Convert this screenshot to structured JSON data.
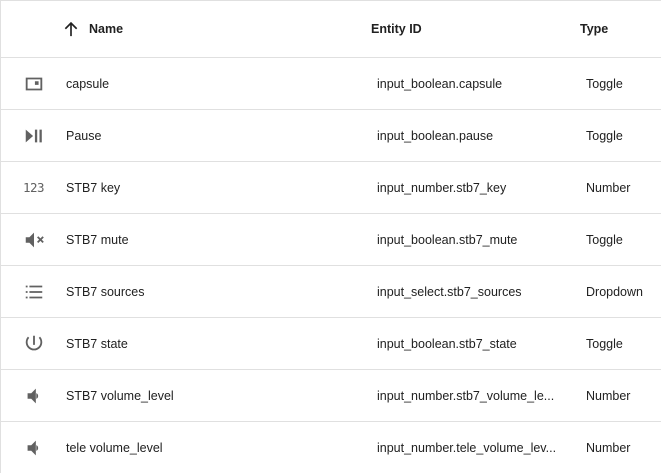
{
  "table": {
    "columns": {
      "name": "Name",
      "entity_id": "Entity ID",
      "type": "Type"
    },
    "sort": {
      "column": "name",
      "direction": "ascending",
      "icon": "arrow-up-icon"
    },
    "rows": [
      {
        "icon": "card-icon",
        "name": "capsule",
        "entity_id": "input_boolean.capsule",
        "type": "Toggle"
      },
      {
        "icon": "play-pause-icon",
        "name": "Pause",
        "entity_id": "input_boolean.pause",
        "type": "Toggle"
      },
      {
        "icon": "numeric-icon",
        "icon_text": "123",
        "name": "STB7 key",
        "entity_id": "input_number.stb7_key",
        "type": "Number"
      },
      {
        "icon": "volume-off-icon",
        "name": "STB7 mute",
        "entity_id": "input_boolean.stb7_mute",
        "type": "Toggle"
      },
      {
        "icon": "list-icon",
        "name": "STB7 sources",
        "entity_id": "input_select.stb7_sources",
        "type": "Dropdown"
      },
      {
        "icon": "power-icon",
        "name": "STB7 state",
        "entity_id": "input_boolean.stb7_state",
        "type": "Toggle"
      },
      {
        "icon": "volume-icon",
        "name": "STB7 volume_level",
        "entity_id": "input_number.stb7_volume_le...",
        "type": "Number"
      },
      {
        "icon": "volume-icon",
        "name": "tele volume_level",
        "entity_id": "input_number.tele_volume_lev...",
        "type": "Number"
      }
    ]
  }
}
